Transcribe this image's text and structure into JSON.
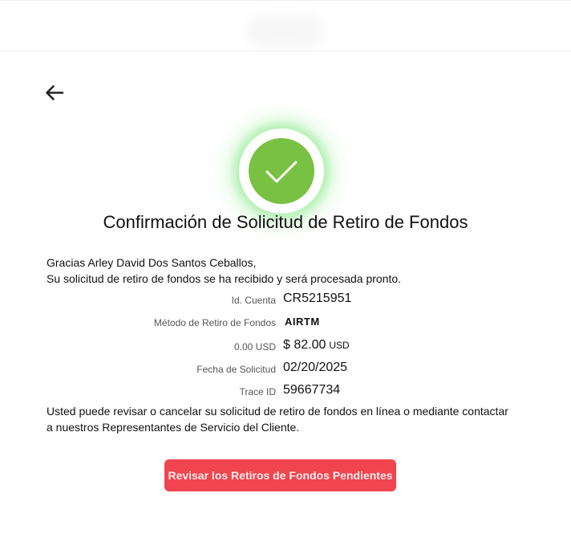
{
  "header": {
    "back_icon": "arrow-left-icon"
  },
  "status": {
    "icon": "check-icon",
    "color": "#79c142"
  },
  "title": "Confirmación de Solicitud de Retiro de Fondos",
  "greeting": {
    "line1": "Gracias Arley David Dos Santos Ceballos,",
    "line2": "Su solicitud de retiro de fondos se ha recibido y será procesada pronto."
  },
  "details": {
    "account": {
      "label": "Id. Cuenta",
      "value": "CR5215951"
    },
    "method": {
      "label": "Método de Retiro de Fondos",
      "value": "AIRTM"
    },
    "amount": {
      "label": "0.00 USD",
      "value": "$ 82.00",
      "currency": "USD"
    },
    "date": {
      "label": "Fecha de Solicitud",
      "value": "02/20/2025"
    },
    "trace": {
      "label": "Trace ID",
      "value": "59667734"
    }
  },
  "note": {
    "line1": "Usted puede revisar o cancelar su solicitud de retiro de fondos en línea o mediante contactar",
    "line2": "a nuestros Representantes de Servicio del Cliente."
  },
  "actions": {
    "review_label": "Revisar los Retiros de Fondos Pendientes",
    "review_color": "#f0454f"
  }
}
